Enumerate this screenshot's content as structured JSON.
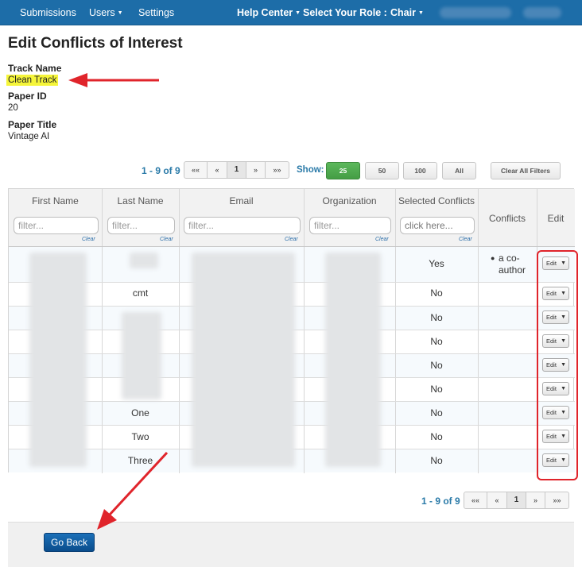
{
  "nav": {
    "submissions": "Submissions",
    "users": "Users",
    "settings": "Settings",
    "help_center": "Help Center",
    "select_role_label": "Select Your Role :",
    "role": "Chair"
  },
  "page": {
    "title": "Edit Conflicts of Interest",
    "track_name_label": "Track Name",
    "track_name": "Clean Track",
    "paper_id_label": "Paper ID",
    "paper_id": "20",
    "paper_title_label": "Paper Title",
    "paper_title": "Vintage AI"
  },
  "pagination": {
    "count": "1 - 9 of 9",
    "bottom_count": "1 - 9 of 9",
    "first": "««",
    "prev": "«",
    "current": "1",
    "next": "»",
    "last": "»»",
    "show_label": "Show:",
    "sizes": [
      "25",
      "50",
      "100",
      "All"
    ],
    "clear_filters": "Clear All Filters"
  },
  "table": {
    "headers": {
      "first_name": "First Name",
      "last_name": "Last Name",
      "email": "Email",
      "organization": "Organization",
      "selected_conflicts": "Selected Conflicts",
      "conflicts": "Conflicts",
      "edit": "Edit"
    },
    "filter_placeholder": "filter...",
    "conflict_placeholder": "click here...",
    "clear_label": "Clear",
    "edit_label": "Edit",
    "rows": [
      {
        "last_name": "",
        "selected": "Yes",
        "conflict": "a co-author"
      },
      {
        "last_name": "cmt",
        "selected": "No",
        "conflict": ""
      },
      {
        "last_name": "",
        "selected": "No",
        "conflict": ""
      },
      {
        "last_name": "",
        "selected": "No",
        "conflict": ""
      },
      {
        "last_name": "",
        "selected": "No",
        "conflict": ""
      },
      {
        "last_name": "",
        "selected": "No",
        "conflict": ""
      },
      {
        "last_name": "One",
        "selected": "No",
        "conflict": ""
      },
      {
        "last_name": "Two",
        "selected": "No",
        "conflict": ""
      },
      {
        "last_name": "Three",
        "selected": "No",
        "conflict": ""
      }
    ]
  },
  "footer": {
    "go_back": "Go Back"
  },
  "colors": {
    "navbar": "#1d6da8",
    "accent_link": "#2a7aa8",
    "highlight": "#f5f53a",
    "annotation_red": "#e0242b",
    "go_back": "#0a4d8c",
    "show_25": "#5cb85c"
  }
}
